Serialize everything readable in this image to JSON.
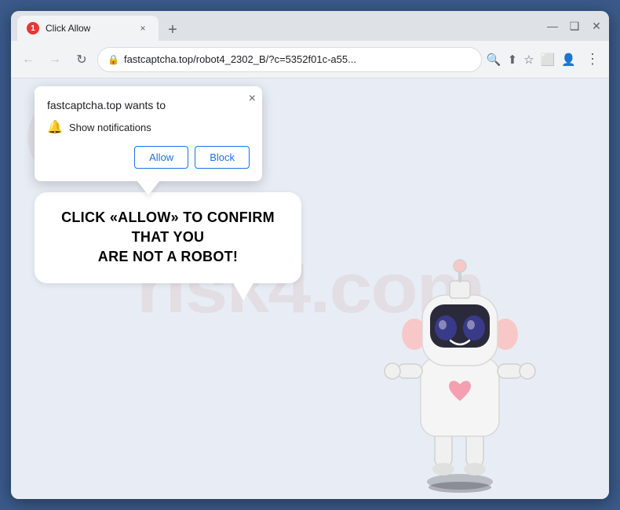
{
  "browser": {
    "tab": {
      "favicon_label": "1",
      "title": "Click Allow",
      "close_label": "×"
    },
    "new_tab_label": "+",
    "window_controls": {
      "minimize": "—",
      "maximize": "❑",
      "close": "✕"
    },
    "nav": {
      "back_label": "←",
      "forward_label": "→",
      "reload_label": "↻"
    },
    "address": {
      "url": "fastcaptcha.top/robot4_2302_B/?c=5352f01c-a55...",
      "lock_symbol": "🔒"
    },
    "toolbar_icons": {
      "search": "🔍",
      "share": "⬆",
      "bookmark": "☆",
      "extension": "⬜",
      "profile": "👤",
      "menu": "⋮"
    }
  },
  "notification_popup": {
    "site": "fastcaptcha.top wants to",
    "permission": "Show notifications",
    "close_label": "×",
    "allow_label": "Allow",
    "block_label": "Block"
  },
  "page": {
    "message_line1": "CLICK «ALLOW» TO CONFIRM THAT YOU",
    "message_line2": "ARE NOT A ROBOT!",
    "watermark": "risk4.com"
  }
}
